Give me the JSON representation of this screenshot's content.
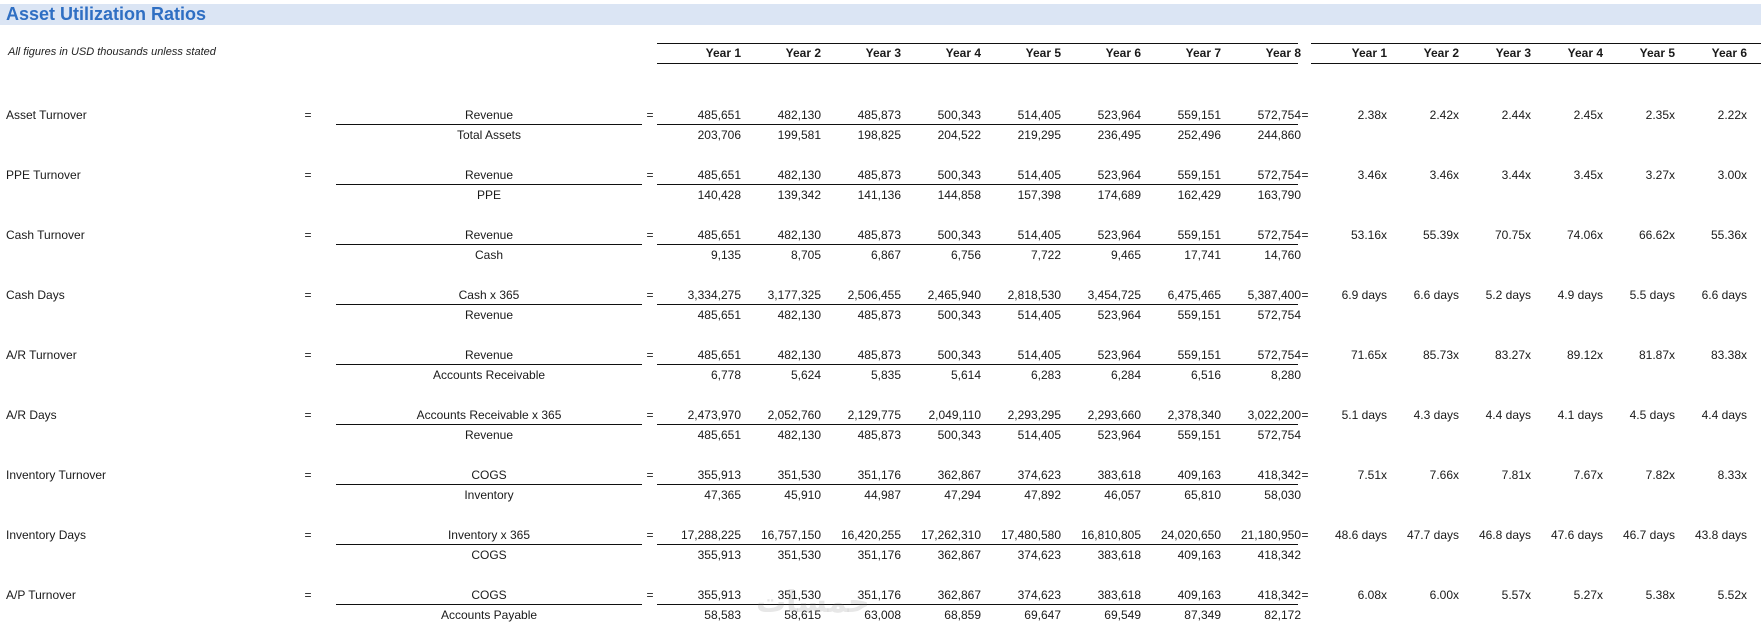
{
  "title": "Asset Utilization Ratios",
  "subtitle": "All figures in USD thousands unless stated",
  "years_left": [
    "Year 1",
    "Year 2",
    "Year 3",
    "Year 4",
    "Year 5",
    "Year 6",
    "Year 7",
    "Year 8"
  ],
  "years_right": [
    "Year 1",
    "Year 2",
    "Year 3",
    "Year 4",
    "Year 5",
    "Year 6"
  ],
  "eq": "=",
  "watermark": "خمسات",
  "ratios": [
    {
      "name": "Asset Turnover",
      "numerator": "Revenue",
      "denominator": "Total Assets",
      "num": [
        "485,651",
        "482,130",
        "485,873",
        "500,343",
        "514,405",
        "523,964",
        "559,151",
        "572,754"
      ],
      "den": [
        "203,706",
        "199,581",
        "198,825",
        "204,522",
        "219,295",
        "236,495",
        "252,496",
        "244,860"
      ],
      "res": [
        "2.38x",
        "2.42x",
        "2.44x",
        "2.45x",
        "2.35x",
        "2.22x"
      ]
    },
    {
      "name": "PPE Turnover",
      "numerator": "Revenue",
      "denominator": "PPE",
      "num": [
        "485,651",
        "482,130",
        "485,873",
        "500,343",
        "514,405",
        "523,964",
        "559,151",
        "572,754"
      ],
      "den": [
        "140,428",
        "139,342",
        "141,136",
        "144,858",
        "157,398",
        "174,689",
        "162,429",
        "163,790"
      ],
      "res": [
        "3.46x",
        "3.46x",
        "3.44x",
        "3.45x",
        "3.27x",
        "3.00x"
      ]
    },
    {
      "name": "Cash Turnover",
      "numerator": "Revenue",
      "denominator": "Cash",
      "num": [
        "485,651",
        "482,130",
        "485,873",
        "500,343",
        "514,405",
        "523,964",
        "559,151",
        "572,754"
      ],
      "den": [
        "9,135",
        "8,705",
        "6,867",
        "6,756",
        "7,722",
        "9,465",
        "17,741",
        "14,760"
      ],
      "res": [
        "53.16x",
        "55.39x",
        "70.75x",
        "74.06x",
        "66.62x",
        "55.36x"
      ]
    },
    {
      "name": "Cash Days",
      "numerator": "Cash x 365",
      "denominator": "Revenue",
      "num": [
        "3,334,275",
        "3,177,325",
        "2,506,455",
        "2,465,940",
        "2,818,530",
        "3,454,725",
        "6,475,465",
        "5,387,400"
      ],
      "den": [
        "485,651",
        "482,130",
        "485,873",
        "500,343",
        "514,405",
        "523,964",
        "559,151",
        "572,754"
      ],
      "res": [
        "6.9 days",
        "6.6 days",
        "5.2 days",
        "4.9 days",
        "5.5 days",
        "6.6 days"
      ]
    },
    {
      "name": "A/R Turnover",
      "numerator": "Revenue",
      "denominator": "Accounts Receivable",
      "num": [
        "485,651",
        "482,130",
        "485,873",
        "500,343",
        "514,405",
        "523,964",
        "559,151",
        "572,754"
      ],
      "den": [
        "6,778",
        "5,624",
        "5,835",
        "5,614",
        "6,283",
        "6,284",
        "6,516",
        "8,280"
      ],
      "res": [
        "71.65x",
        "85.73x",
        "83.27x",
        "89.12x",
        "81.87x",
        "83.38x"
      ]
    },
    {
      "name": "A/R Days",
      "numerator": "Accounts Receivable x 365",
      "denominator": "Revenue",
      "num": [
        "2,473,970",
        "2,052,760",
        "2,129,775",
        "2,049,110",
        "2,293,295",
        "2,293,660",
        "2,378,340",
        "3,022,200"
      ],
      "den": [
        "485,651",
        "482,130",
        "485,873",
        "500,343",
        "514,405",
        "523,964",
        "559,151",
        "572,754"
      ],
      "res": [
        "5.1 days",
        "4.3 days",
        "4.4 days",
        "4.1 days",
        "4.5 days",
        "4.4 days"
      ]
    },
    {
      "name": "Inventory Turnover",
      "numerator": "COGS",
      "denominator": "Inventory",
      "num": [
        "355,913",
        "351,530",
        "351,176",
        "362,867",
        "374,623",
        "383,618",
        "409,163",
        "418,342"
      ],
      "den": [
        "47,365",
        "45,910",
        "44,987",
        "47,294",
        "47,892",
        "46,057",
        "65,810",
        "58,030"
      ],
      "res": [
        "7.51x",
        "7.66x",
        "7.81x",
        "7.67x",
        "7.82x",
        "8.33x"
      ]
    },
    {
      "name": "Inventory Days",
      "numerator": "Inventory x 365",
      "denominator": "COGS",
      "num": [
        "17,288,225",
        "16,757,150",
        "16,420,255",
        "17,262,310",
        "17,480,580",
        "16,810,805",
        "24,020,650",
        "21,180,950"
      ],
      "den": [
        "355,913",
        "351,530",
        "351,176",
        "362,867",
        "374,623",
        "383,618",
        "409,163",
        "418,342"
      ],
      "res": [
        "48.6 days",
        "47.7 days",
        "46.8 days",
        "47.6 days",
        "46.7 days",
        "43.8 days"
      ]
    },
    {
      "name": "A/P Turnover",
      "numerator": "COGS",
      "denominator": "Accounts Payable",
      "num": [
        "355,913",
        "351,530",
        "351,176",
        "362,867",
        "374,623",
        "383,618",
        "409,163",
        "418,342"
      ],
      "den": [
        "58,583",
        "58,615",
        "63,008",
        "68,859",
        "69,647",
        "69,549",
        "87,349",
        "82,172"
      ],
      "res": [
        "6.08x",
        "6.00x",
        "5.57x",
        "5.27x",
        "5.38x",
        "5.52x"
      ]
    }
  ]
}
